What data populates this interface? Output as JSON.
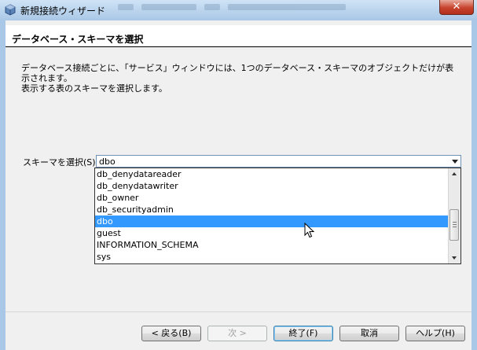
{
  "window": {
    "title": "新規接続ウィザード",
    "close_label": "✕",
    "close_icon": "close-icon",
    "app_icon": "netbeans-cube-icon"
  },
  "step": {
    "title": "データベース・スキーマを選択"
  },
  "description": {
    "line1": "データベース接続ごとに、「サービス」ウィンドウには、1つのデータベース・スキーマのオブジェクトだけが表示されます。",
    "line2": "表示する表のスキーマを選択します。"
  },
  "schema": {
    "label": "スキーマを選択(S):",
    "selected": "dbo",
    "options": [
      "db_denydatareader",
      "db_denydatawriter",
      "db_owner",
      "db_securityadmin",
      "dbo",
      "guest",
      "INFORMATION_SCHEMA",
      "sys"
    ],
    "highlighted_index": 4
  },
  "buttons": {
    "back": "< 戻る(B)",
    "next": "次 >",
    "finish": "終了(F)",
    "cancel": "取消",
    "help": "ヘルプ(H)"
  },
  "colors": {
    "selection": "#3399ff",
    "close_button": "#c7432e"
  }
}
